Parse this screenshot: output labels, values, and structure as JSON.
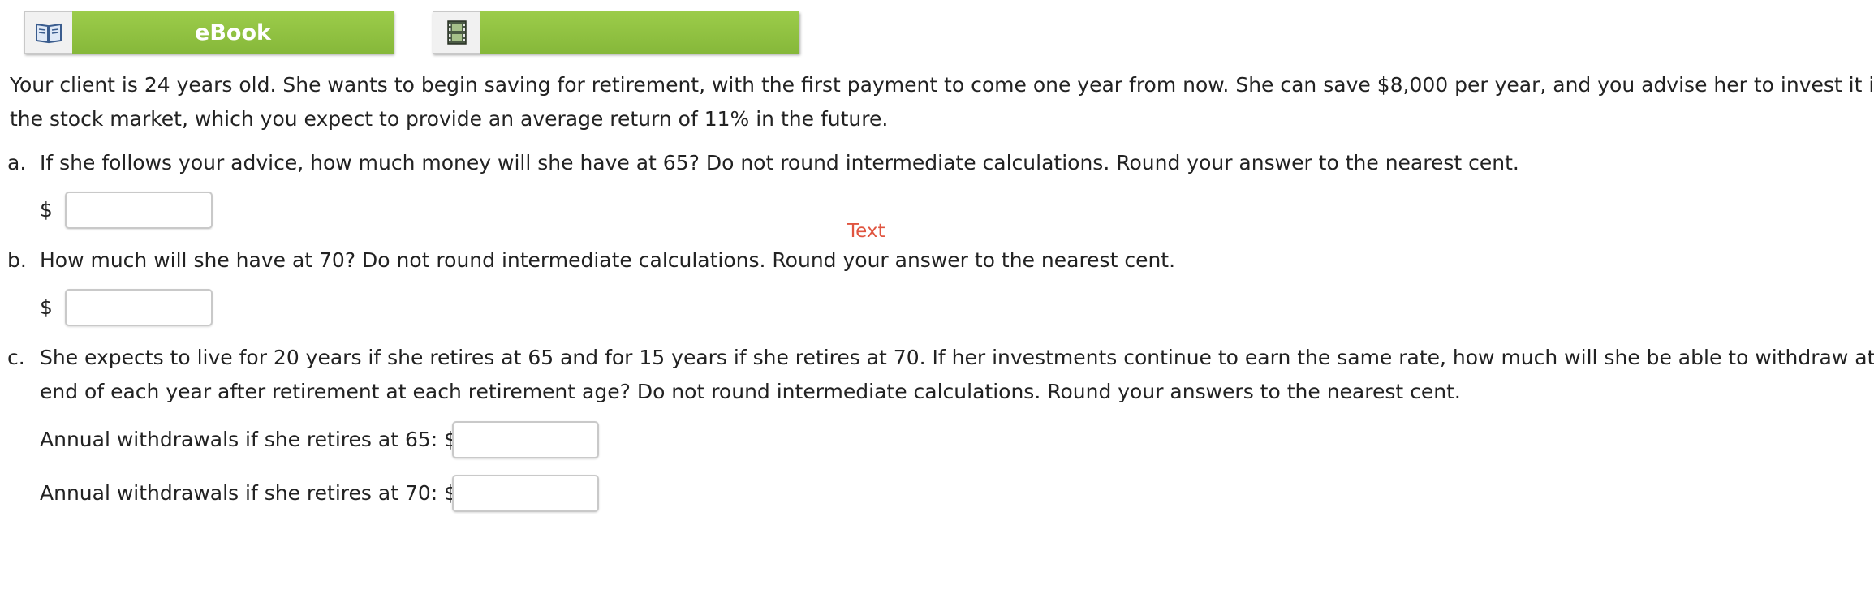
{
  "resources": {
    "ebook": {
      "label": "eBook",
      "icon": "book-icon"
    },
    "media": {
      "label": "",
      "icon": "film-icon"
    }
  },
  "question": {
    "intro_line1": "Your client is 24 years old. She wants to begin saving for retirement, with the first payment to come one year from now. She can save $8,000 per year, and you advise her to invest it in",
    "intro_line2": "the stock market, which you expect to provide an average return of 11% in the future.",
    "parts": {
      "a": {
        "marker": "a.",
        "text": "If she follows your advice, how much money will she have at 65? Do not round intermediate calculations. Round your answer to the nearest cent.",
        "currency": "$",
        "value": ""
      },
      "b": {
        "marker": "b.",
        "text": "How much will she have at 70? Do not round intermediate calculations. Round your answer to the nearest cent.",
        "currency": "$",
        "value": ""
      },
      "c": {
        "marker": "c.",
        "text_line1": "She expects to live for 20 years if she retires at 65 and for 15 years if she retires at 70. If her investments continue to earn the same rate, how much will she be able to withdraw at the",
        "text_line2": "end of each year after retirement at each retirement age? Do not round intermediate calculations. Round your answers to the nearest cent.",
        "withdrawal_65_label": "Annual withdrawals if she retires at 65: $",
        "withdrawal_65_value": "",
        "withdrawal_70_label": "Annual withdrawals if she retires at 70: $",
        "withdrawal_70_value": ""
      }
    }
  },
  "overlay_text": "Text",
  "colors": {
    "button_green": "#8fc040",
    "overlay_red": "#e05540",
    "text": "#222222"
  }
}
